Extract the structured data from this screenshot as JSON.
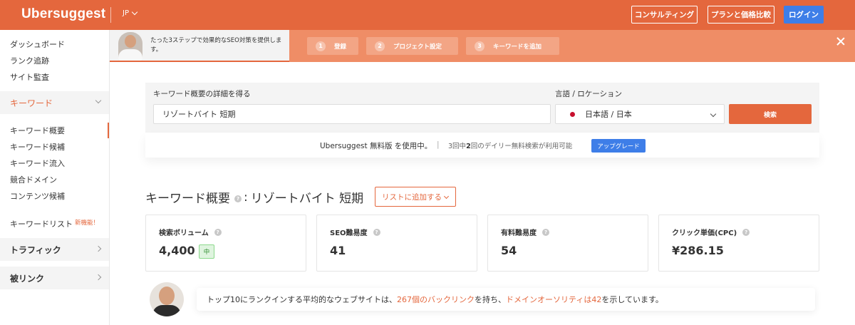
{
  "header": {
    "logo": "Ubersuggest",
    "locale": "JP",
    "consulting_label": "コンサルティング",
    "pricing_label": "プランと価格比較",
    "login_label": "ログイン"
  },
  "colors": {
    "brand": "#e4673d",
    "accent_blue": "#3e7ee8",
    "banner": "#ef8d66"
  },
  "sidebar": {
    "dashboard": "ダッシュボード",
    "rank_tracking": "ランク追跡",
    "site_audit": "サイト監査",
    "keyword_section": "キーワード",
    "keyword_items": [
      "キーワード概要",
      "キーワード候補",
      "キーワード流入",
      "競合ドメイン",
      "コンテンツ候補"
    ],
    "keyword_list": "キーワードリスト",
    "new_badge": "新機能！",
    "traffic_section": "トラフィック",
    "backlinks_section": "被リンク"
  },
  "onboarding": {
    "text": "たった3ステップで効果的なSEO対策を提供します。",
    "steps": [
      {
        "num": "1",
        "label": "登録"
      },
      {
        "num": "2",
        "label": "プロジェクト設定"
      },
      {
        "num": "3",
        "label": "キーワードを追加"
      }
    ]
  },
  "search": {
    "keyword_label": "キーワード概要の詳細を得る",
    "keyword_value": "リゾートバイト 短期",
    "location_label": "言語 / ロケーション",
    "location_value": "日本語 / 日本",
    "search_button": "検索"
  },
  "freebar": {
    "main_text": "Ubersuggest 無料版 を使用中。",
    "sep": "|",
    "usage_prefix": "3",
    "usage_mid": "回中",
    "usage_used": "2",
    "usage_suffix": "回のデイリー無料検索が利用可能",
    "upgrade_button": "アップグレード"
  },
  "overview": {
    "title_prefix": "キーワード概要",
    "title_colon": ":",
    "keyword": "リゾートバイト 短期",
    "add_to_list": "リストに追加する",
    "help_glyph": "?"
  },
  "metrics": [
    {
      "label": "検索ボリューム",
      "value": "4,400",
      "badge": "中"
    },
    {
      "label": "SEO難易度",
      "value": "41"
    },
    {
      "label": "有料難易度",
      "value": "54"
    },
    {
      "label": "クリック単価(CPC)",
      "value": "¥286.15"
    }
  ],
  "insight": {
    "part1": "トップ10にランクインする平均的なウェブサイトは、",
    "hl1": "267個のバックリンク",
    "part2": "を持ち、",
    "hl2": "ドメインオーソリティは42",
    "part3": "を示しています。"
  }
}
